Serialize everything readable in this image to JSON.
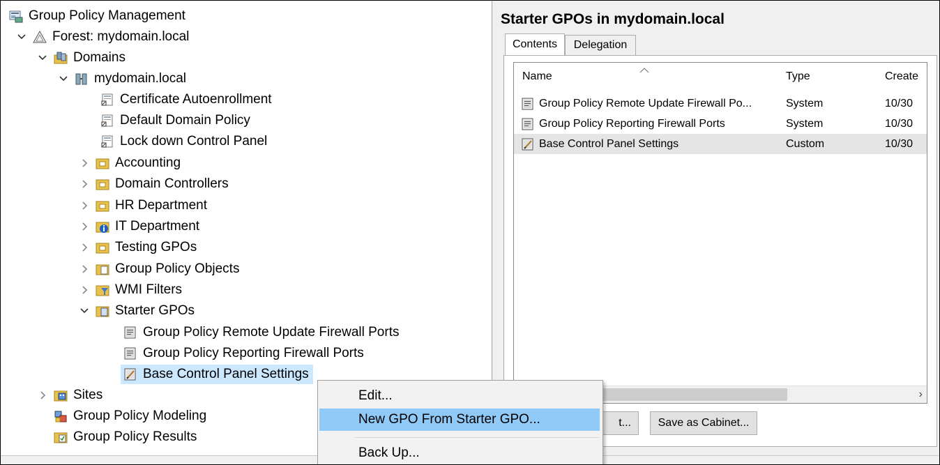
{
  "tree": {
    "root": "Group Policy Management",
    "forest": "Forest: mydomain.local",
    "domains": "Domains",
    "domain": "mydomain.local",
    "links": [
      "Certificate Autoenrollment",
      "Default Domain Policy",
      "Lock down Control Panel"
    ],
    "ous": [
      "Accounting",
      "Domain Controllers",
      "HR Department",
      "IT Department",
      "Testing GPOs"
    ],
    "gpo_objects": "Group Policy Objects",
    "wmi_filters": "WMI Filters",
    "starter_gpos": "Starter GPOs",
    "starters": [
      "Group Policy Remote Update Firewall Ports",
      "Group Policy Reporting Firewall Ports",
      "Base Control Panel Settings"
    ],
    "sites": "Sites",
    "modeling": "Group Policy Modeling",
    "results": "Group Policy Results"
  },
  "right": {
    "title": "Starter GPOs in mydomain.local",
    "tabs": [
      "Contents",
      "Delegation"
    ],
    "columns": [
      "Name",
      "Type",
      "Create"
    ],
    "rows": [
      {
        "name": "Group Policy Remote Update Firewall Po...",
        "type": "System",
        "created": "10/30"
      },
      {
        "name": "Group Policy Reporting Firewall Ports",
        "type": "System",
        "created": "10/30"
      },
      {
        "name": "Base Control Panel Settings",
        "type": "Custom",
        "created": "10/30"
      }
    ],
    "scroll_right": "›",
    "load_button_visible": "t...",
    "save_button": "Save as Cabinet..."
  },
  "context_menu": {
    "items": [
      "Edit...",
      "New GPO From Starter GPO...",
      "Back Up..."
    ],
    "highlighted": "New GPO From Starter GPO..."
  },
  "colors": {
    "selection": "#cce8ff",
    "menu_highlight": "#91c9f7",
    "folder_yellow": "#e8c24a"
  }
}
